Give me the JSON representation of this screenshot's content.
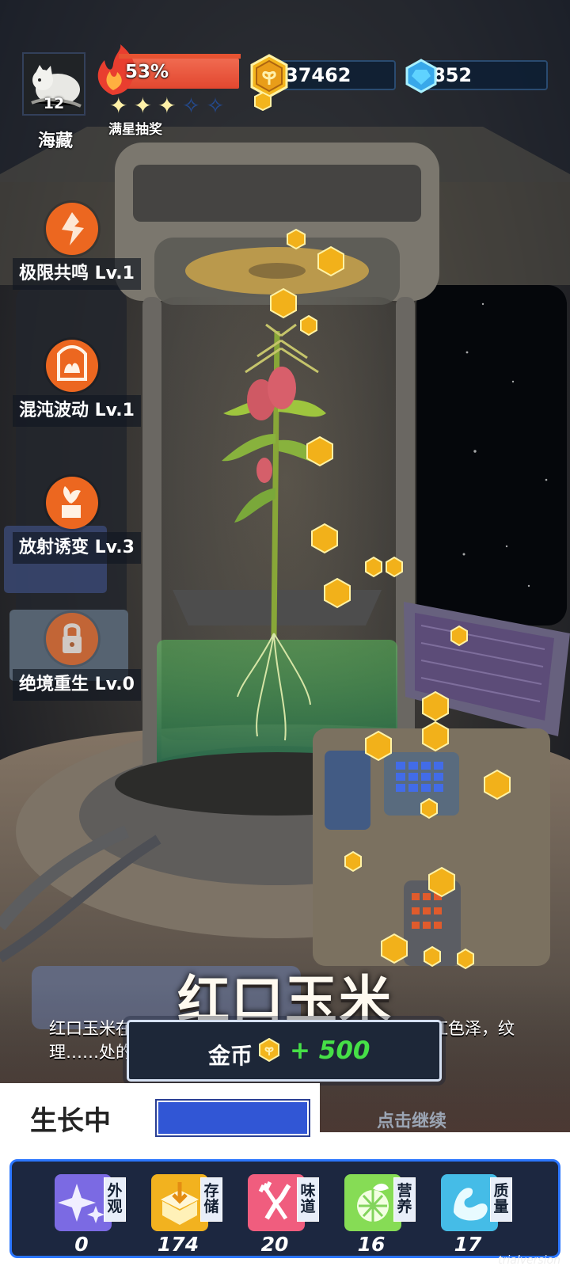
{
  "player": {
    "name": "海藏",
    "level": "12"
  },
  "hud": {
    "fire_percent": "53%",
    "star_label": "满星抽奖",
    "coins": "37462",
    "gems": "852",
    "stars_filled": 3,
    "stars_total": 5
  },
  "skills": [
    {
      "label": "极限共鸣 Lv.1",
      "icon": "resonance-icon"
    },
    {
      "label": "混沌波动 Lv.1",
      "icon": "chaos-icon"
    },
    {
      "label": "放射诱变 Lv.3",
      "icon": "mutation-icon"
    },
    {
      "label": "绝境重生 Lv.0",
      "icon": "lock-icon"
    }
  ],
  "plant": {
    "title": "红口玉米",
    "description": "红口玉米在极限共鸣的刺激下完成进化，籽粒转为深红色泽，纹理……处的力量。"
  },
  "reward": {
    "label": "金币",
    "amount": "+ 500"
  },
  "continue_label": "点击继续",
  "growth": {
    "label": "生长中",
    "progress": 1.0
  },
  "stats": [
    {
      "tag": "外观",
      "value": "0",
      "icon": "sparkle-icon"
    },
    {
      "tag": "存储",
      "value": "174",
      "icon": "box-icon"
    },
    {
      "tag": "味道",
      "value": "20",
      "icon": "utensils-icon"
    },
    {
      "tag": "营养",
      "value": "16",
      "icon": "lime-icon"
    },
    {
      "tag": "质量",
      "value": "17",
      "icon": "muscle-icon"
    }
  ],
  "watermark": "trialversion",
  "colors": {
    "accent_orange": "#ec6720",
    "coin_gold": "#f2b11a",
    "progress_blue": "#3156d5",
    "reward_green": "#46e047"
  }
}
